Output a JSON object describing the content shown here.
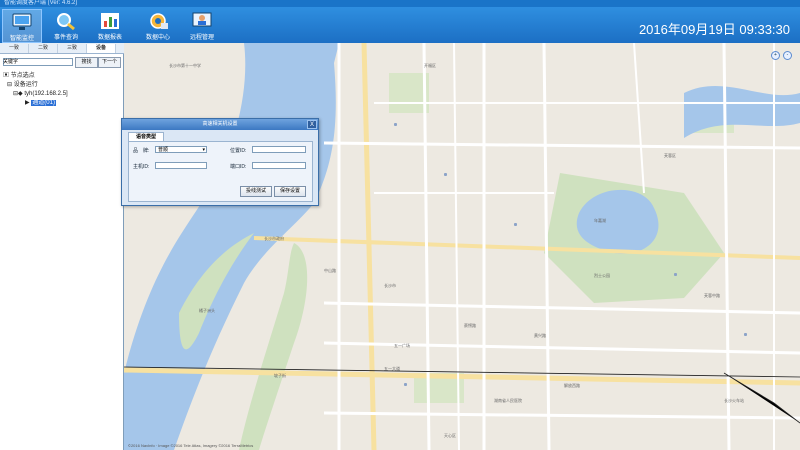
{
  "window": {
    "title": "智能调度客户端 (Ver: 4.6.2)"
  },
  "toolbar": {
    "items": [
      {
        "label": "智能监控",
        "icon": "monitor-icon"
      },
      {
        "label": "事件查询",
        "icon": "search-icon"
      },
      {
        "label": "数据报表",
        "icon": "chart-icon"
      },
      {
        "label": "数据中心",
        "icon": "gear-icon"
      },
      {
        "label": "远程管理",
        "icon": "remote-icon"
      }
    ],
    "clock": "2016年09月19日 09:33:30"
  },
  "left_tabs": [
    "一致",
    "二致",
    "三致",
    "设备"
  ],
  "search": {
    "label": "关键字",
    "search_btn": "搜找",
    "next_btn": "下一个"
  },
  "tree": {
    "root": "节点选点",
    "group": "设备运行",
    "device": "tyh(192.168.2.5]",
    "channel": "通道(01)"
  },
  "dialog": {
    "title": "高速相关机设置",
    "tab": "语音类型",
    "brand_label": "品　牌:",
    "brand_value": "普顺",
    "location_label": "位置ID:",
    "host_label": "主机ID:",
    "port_label": "端口ID:",
    "test_btn": "投线测试",
    "save_btn": "保存设置",
    "close": "X"
  },
  "map": {
    "labels": [
      "长沙市第十一中学",
      "湘江",
      "橘子洲头",
      "长沙市",
      "五一大道",
      "芙蓉区",
      "天心区",
      "年嘉湖",
      "烈士公园",
      "长沙火车站",
      "湖南省人民医院",
      "蔡锷路",
      "黄兴路",
      "五一广场",
      "坡子街",
      "长沙市政府",
      "中山路",
      "解放西路",
      "芙蓉中路",
      "开福区"
    ],
    "copyright": "©2016 NavInfo · Image ©2016 Tele Atlas, Imagery ©2016 TerraMetrics",
    "zoom_in": "+",
    "zoom_out": "-"
  },
  "colors": {
    "toolbar": "#1c6fc4",
    "water": "#a5c6ea",
    "park": "#cfe1bf",
    "road": "#ffffff",
    "major_road": "#f7e1a0"
  }
}
